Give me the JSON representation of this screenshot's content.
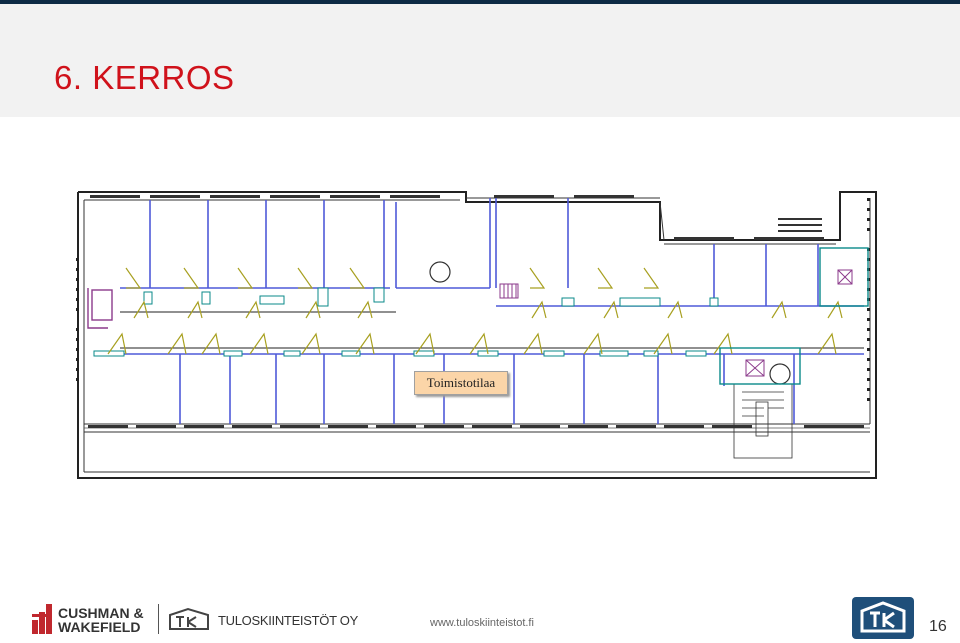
{
  "slide": {
    "title": "6. KERROS",
    "space_label": "Toimistotilaa",
    "footer": {
      "cw_line1": "CUSHMAN &",
      "cw_line2": "WAKEFIELD",
      "tk_name": "TULOSKIINTEISTÖT OY",
      "url": "www.tuloskiinteistot.fi",
      "page_number": "16"
    }
  },
  "colors": {
    "title": "#d0121b",
    "header_bg": "#f2f2f2",
    "top_bar": "#0d2b45",
    "label_bg": "#fbd5a8",
    "wall_blue": "#4f5ad8",
    "teal": "#0a8a8a",
    "door": "#a8a020",
    "brand_red": "#c0282e"
  },
  "icons": [
    "cushman-wakefield-logo-icon",
    "tuloskiinteistot-logo-icon",
    "tk-badge-icon"
  ]
}
